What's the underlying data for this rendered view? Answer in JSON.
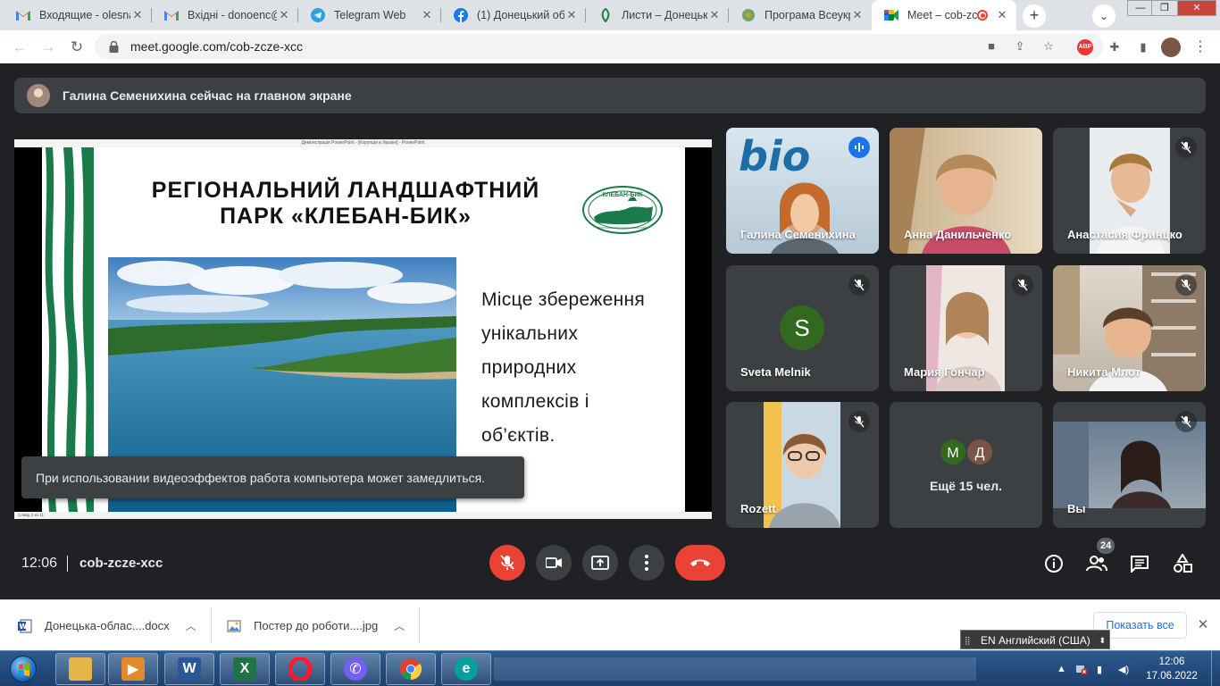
{
  "browser": {
    "tabs": [
      {
        "title": "Входящие - olesna",
        "icon": "gmail-icon"
      },
      {
        "title": "Вхідні - donoenc@",
        "icon": "gmail-icon"
      },
      {
        "title": "Telegram Web",
        "icon": "telegram-icon"
      },
      {
        "title": "(1) Донецький об",
        "icon": "facebook-icon"
      },
      {
        "title": "Листи – Донецьк",
        "icon": "leaf-icon"
      },
      {
        "title": "Програма Всеукр",
        "icon": "globe-icon"
      },
      {
        "title": "Meet – cob-zcz",
        "icon": "meet-icon",
        "active": true
      }
    ],
    "url": "meet.google.com/cob-zcze-xcc"
  },
  "meet": {
    "presenting_banner": "Галина Семенихина сейчас на главном экране",
    "shared_window_title": "Демонстрація PowerPoint - [Корупція в Україні] - PowerPoint",
    "slide_status": "Слайд 2 из 11",
    "slide": {
      "title_line1": "РЕГІОНАЛЬНИЙ ЛАНДШАФТНИЙ",
      "title_line2": "ПАРК «КЛЕБАН-БИК»",
      "logo_text": "КЛЕБАН-БИК",
      "logo_subtext": "РЕГІОНАЛЬНИЙ ЛАНДШАФТНИЙ ПАРК",
      "body_lines": [
        "Місце збереження",
        "унікальних",
        "природних",
        "комплексів і",
        "об’єктів."
      ]
    },
    "toast": "При использовании видеоэффектов работа компьютера может замедлиться.",
    "participants": [
      {
        "name": "Галина Семенихина",
        "mic": "speaking"
      },
      {
        "name": "Анна Данильченко",
        "mic": "on"
      },
      {
        "name": "Анастасия Фринцко",
        "mic": "muted"
      },
      {
        "name": "Sveta Melnik",
        "mic": "muted",
        "initial": "S"
      },
      {
        "name": "Мария Гончар",
        "mic": "muted"
      },
      {
        "name": "Никита Млот",
        "mic": "muted"
      },
      {
        "name": "Rozett",
        "mic": "muted"
      },
      {
        "name": "Ещё 15 чел.",
        "initials": [
          "М",
          "Д"
        ]
      },
      {
        "name": "Вы",
        "mic": "muted"
      }
    ],
    "time": "12:06",
    "meeting_code": "cob-zcze-xcc",
    "people_count": "24",
    "colors": {
      "hangup": "#ea4335",
      "speaking_outline": "#8ab4f8",
      "avatar_green": "#33691e",
      "avatar_brown": "#795548"
    }
  },
  "downloads": {
    "items": [
      {
        "name": "Донецька-облас....docx",
        "icon": "word-file-icon"
      },
      {
        "name": "Постер до роботи....jpg",
        "icon": "image-file-icon"
      }
    ],
    "show_all": "Показать все",
    "language_indicator": "EN Английский (США)"
  },
  "taskbar": {
    "apps": [
      "explorer",
      "media-player",
      "word",
      "excel",
      "opera",
      "viber",
      "chrome",
      "eset"
    ],
    "clock_time": "12:06",
    "clock_date": "17.06.2022"
  }
}
